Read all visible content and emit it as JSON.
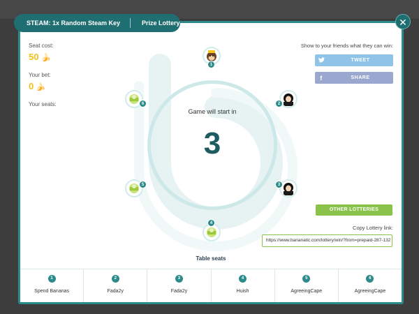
{
  "header": {
    "item_title": "STEAM: 1x Random Steam Key",
    "lottery_type": "Prize Lottery"
  },
  "close_label": "✕",
  "left_info": {
    "seat_cost_label": "Seat cost:",
    "seat_cost_value": "50",
    "your_bet_label": "Your bet:",
    "your_bet_value": "0",
    "your_seats_label": "Your seats:"
  },
  "share": {
    "text": "Show to your friends what they can win:",
    "tweet_label": "TWEET",
    "share_label": "SHARE"
  },
  "game": {
    "start_text": "Game will start in",
    "countdown": "3"
  },
  "table_seats_label": "Table seats",
  "other_lotteries_label": "OTHER LOTTERIES",
  "copy_link_label": "Copy Lottery link:",
  "copy_link_value": "https://www.bananatic.com/lottery/win/?from=prepaid-287-132",
  "seats_ring": [
    "1",
    "2",
    "3",
    "4",
    "5",
    "6"
  ],
  "seat_bar": [
    {
      "num": "1",
      "name": "Spend Bananas"
    },
    {
      "num": "2",
      "name": "Fada2y"
    },
    {
      "num": "3",
      "name": "Fada2y"
    },
    {
      "num": "4",
      "name": "Huish"
    },
    {
      "num": "5",
      "name": "AgreeingCape"
    },
    {
      "num": "6",
      "name": "AgreeingCape"
    }
  ],
  "colors": {
    "accent": "#1f6e72",
    "coin": "#f1c21b",
    "green": "#8bc34a"
  }
}
